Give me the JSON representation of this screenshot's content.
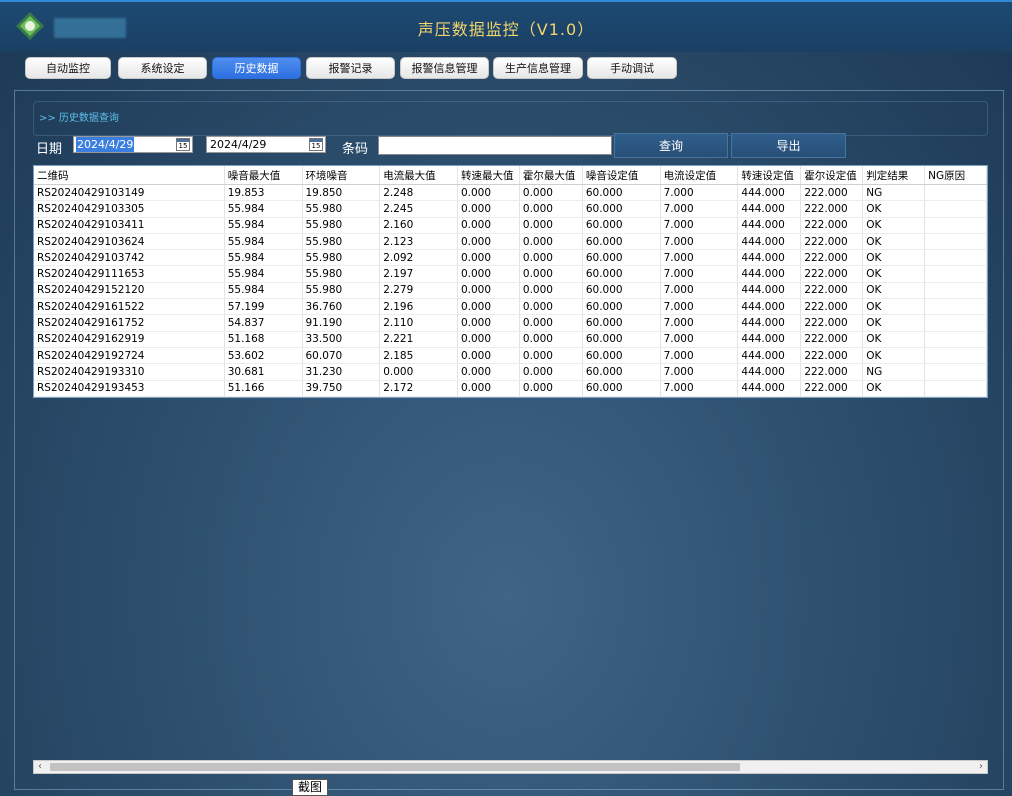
{
  "header": {
    "title": "声压数据监控（V1.0）"
  },
  "tabs": [
    {
      "label": "自动监控",
      "active": false
    },
    {
      "label": "系统设定",
      "active": false
    },
    {
      "label": "历史数据",
      "active": true
    },
    {
      "label": "报警记录",
      "active": false
    },
    {
      "label": "报警信息管理",
      "active": false
    },
    {
      "label": "生产信息管理",
      "active": false
    },
    {
      "label": "手动调试",
      "active": false
    }
  ],
  "query": {
    "section_title": ">> 历史数据查询",
    "date_label": "日期",
    "start_date": "2024/4/29",
    "end_date": "2024/4/29",
    "calendar_day": "15",
    "barcode_label": "条码",
    "barcode_value": "",
    "query_button": "查询",
    "export_button": "导出"
  },
  "table": {
    "columns": [
      "二维码",
      "噪音最大值",
      "环境噪音",
      "电流最大值",
      "转速最大值",
      "霍尔最大值",
      "噪音设定值",
      "电流设定值",
      "转速设定值",
      "霍尔设定值",
      "判定结果",
      "NG原因"
    ],
    "rows": [
      [
        "RS20240429103149",
        "19.853",
        "19.850",
        "2.248",
        "0.000",
        "0.000",
        "60.000",
        "7.000",
        "444.000",
        "222.000",
        "NG",
        ""
      ],
      [
        "RS20240429103305",
        "55.984",
        "55.980",
        "2.245",
        "0.000",
        "0.000",
        "60.000",
        "7.000",
        "444.000",
        "222.000",
        "OK",
        ""
      ],
      [
        "RS20240429103411",
        "55.984",
        "55.980",
        "2.160",
        "0.000",
        "0.000",
        "60.000",
        "7.000",
        "444.000",
        "222.000",
        "OK",
        ""
      ],
      [
        "RS20240429103624",
        "55.984",
        "55.980",
        "2.123",
        "0.000",
        "0.000",
        "60.000",
        "7.000",
        "444.000",
        "222.000",
        "OK",
        ""
      ],
      [
        "RS20240429103742",
        "55.984",
        "55.980",
        "2.092",
        "0.000",
        "0.000",
        "60.000",
        "7.000",
        "444.000",
        "222.000",
        "OK",
        ""
      ],
      [
        "RS20240429111653",
        "55.984",
        "55.980",
        "2.197",
        "0.000",
        "0.000",
        "60.000",
        "7.000",
        "444.000",
        "222.000",
        "OK",
        ""
      ],
      [
        "RS20240429152120",
        "55.984",
        "55.980",
        "2.279",
        "0.000",
        "0.000",
        "60.000",
        "7.000",
        "444.000",
        "222.000",
        "OK",
        ""
      ],
      [
        "RS20240429161522",
        "57.199",
        "36.760",
        "2.196",
        "0.000",
        "0.000",
        "60.000",
        "7.000",
        "444.000",
        "222.000",
        "OK",
        ""
      ],
      [
        "RS20240429161752",
        "54.837",
        "91.190",
        "2.110",
        "0.000",
        "0.000",
        "60.000",
        "7.000",
        "444.000",
        "222.000",
        "OK",
        ""
      ],
      [
        "RS20240429162919",
        "51.168",
        "33.500",
        "2.221",
        "0.000",
        "0.000",
        "60.000",
        "7.000",
        "444.000",
        "222.000",
        "OK",
        ""
      ],
      [
        "RS20240429192724",
        "53.602",
        "60.070",
        "2.185",
        "0.000",
        "0.000",
        "60.000",
        "7.000",
        "444.000",
        "222.000",
        "OK",
        ""
      ],
      [
        "RS20240429193310",
        "30.681",
        "31.230",
        "0.000",
        "0.000",
        "0.000",
        "60.000",
        "7.000",
        "444.000",
        "222.000",
        "NG",
        ""
      ],
      [
        "RS20240429193453",
        "51.166",
        "39.750",
        "2.172",
        "0.000",
        "0.000",
        "60.000",
        "7.000",
        "444.000",
        "222.000",
        "OK",
        ""
      ]
    ]
  },
  "tooltip": {
    "text": "截图"
  },
  "colors": {
    "title": "#f2d46b",
    "active_tab": "#2d6fe0",
    "section_title": "#5fc0ea"
  }
}
